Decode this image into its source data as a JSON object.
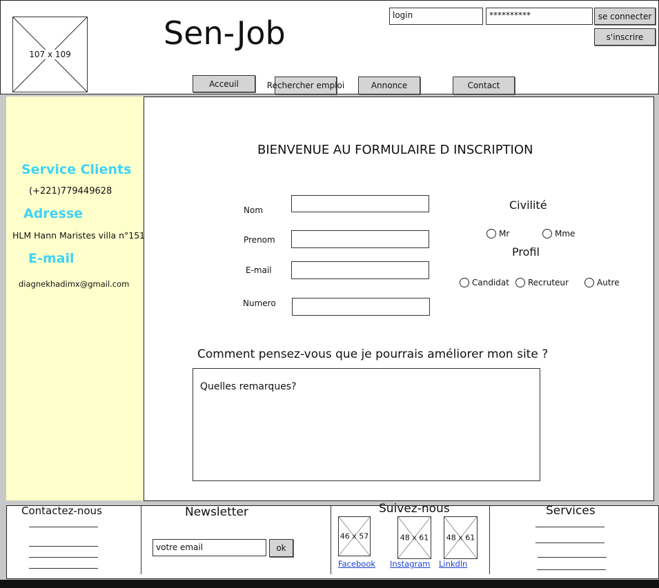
{
  "header": {
    "logo_placeholder": "107 x 109",
    "site_title": "Sen-Job",
    "login_value": "login",
    "password_value": "**********",
    "connect_label": "se connecter",
    "signup_label": "s'inscrire",
    "nav": [
      "Acceuil",
      "Rechercher emploi",
      "Annonce",
      "Contact"
    ]
  },
  "sidebar": {
    "service_title": "Service Clients",
    "phone": "(+221)779449628",
    "address_title": "Adresse",
    "address": "HLM Hann Maristes villa n°151",
    "email_title": "E-mail",
    "email": "diagnekhadimx@gmail.com"
  },
  "form": {
    "title": "BIENVENUE AU FORMULAIRE D INSCRIPTION",
    "labels": {
      "nom": "Nom",
      "prenom": "Prenom",
      "email": "E-mail",
      "numero": "Numero"
    },
    "civilite_title": "Civilité",
    "civilite_options": [
      "Mr",
      "Mme"
    ],
    "profil_title": "Profil",
    "profil_options": [
      "Candidat",
      "Recruteur",
      "Autre"
    ],
    "question": "Comment pensez-vous que je pourrais améliorer mon site ?",
    "remarks_placeholder": "Quelles remarques?"
  },
  "footer": {
    "contact_title": "Contactez-nous",
    "newsletter_title": "Newsletter",
    "newsletter_value": "votre email",
    "ok_label": "ok",
    "follow_title": "Suivez-nous",
    "social": [
      {
        "size": "46 x 57",
        "label": "Facebook"
      },
      {
        "size": "48 x 61",
        "label": "Instagram"
      },
      {
        "size": "48 x 61",
        "label": "Linkdln"
      }
    ],
    "services_title": "Services"
  }
}
